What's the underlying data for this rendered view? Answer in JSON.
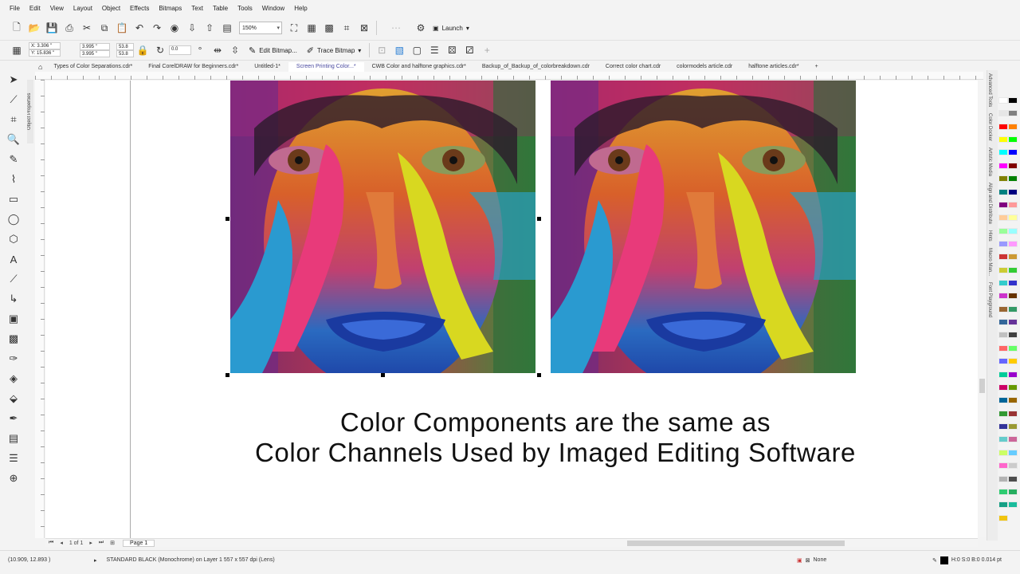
{
  "menu": [
    "File",
    "Edit",
    "View",
    "Layout",
    "Object",
    "Effects",
    "Bitmaps",
    "Text",
    "Table",
    "Tools",
    "Window",
    "Help"
  ],
  "toolbar": {
    "zoom": "150%",
    "launch_label": "Launch"
  },
  "propbar": {
    "x": "X: 3.306 \"",
    "y": "Y: 15.836 \"",
    "w": "3.995 \"",
    "h": "3.995 \"",
    "scale_w": "53.8",
    "scale_h": "53.8",
    "rotation": "0.0",
    "edit_bitmap": "Edit Bitmap...",
    "trace_bitmap": "Trace Bitmap"
  },
  "tabs": [
    {
      "label": "Types of Color Separations.cdr*",
      "active": false
    },
    {
      "label": "Final CorelDRAW for Beginners.cdr*",
      "active": false
    },
    {
      "label": "Untitled-1*",
      "active": false
    },
    {
      "label": "Screen Printing Color...*",
      "active": true
    },
    {
      "label": "CWB Color and halftone graphics.cdr*",
      "active": false
    },
    {
      "label": "Backup_of_Backup_of_colorbreakdown.cdr",
      "active": false
    },
    {
      "label": "Correct color chart.cdr",
      "active": false
    },
    {
      "label": "colormodels article.cdr",
      "active": false
    },
    {
      "label": "halftone articles.cdr*",
      "active": false
    }
  ],
  "side_docker_label": "Object Properties",
  "right_dockers": [
    "Advanced Tools",
    "Color Docker",
    "Artistic Media",
    "Align and Distribute",
    "Hints",
    "Macro Man...",
    "Font Playground"
  ],
  "canvas": {
    "caption_line1": "Color Components are the same as",
    "caption_line2": "Color Channels Used by Imaged Editing Software"
  },
  "pagenav": {
    "counter": "1 of 1",
    "page_label": "Page 1"
  },
  "status": {
    "cursor": "(10.909, 12.893 )",
    "description": "STANDARD BLACK (Monochrome) on Layer 1 557 x 557 dpi (Lens)",
    "fill": "None",
    "outline": "H:0 S:0 B:0  0.014 pt"
  },
  "palette_colors": [
    "#ffffff",
    "#000000",
    "#e6e6e6",
    "#808080",
    "#ff0000",
    "#ff8000",
    "#ffff00",
    "#00ff00",
    "#00ffff",
    "#0000ff",
    "#ff00ff",
    "#800000",
    "#808000",
    "#008000",
    "#008080",
    "#000080",
    "#800080",
    "#ff9999",
    "#ffcc99",
    "#ffff99",
    "#99ff99",
    "#99ffff",
    "#9999ff",
    "#ff99ff",
    "#cc3333",
    "#cc9933",
    "#cccc33",
    "#33cc33",
    "#33cccc",
    "#3333cc",
    "#cc33cc",
    "#663300",
    "#996633",
    "#339966",
    "#336699",
    "#663399",
    "#c0c0c0",
    "#404040",
    "#ff6666",
    "#66ff66",
    "#6666ff",
    "#ffcc00",
    "#00cc99",
    "#9900cc",
    "#cc0066",
    "#669900",
    "#006699",
    "#996600",
    "#339933",
    "#993333",
    "#333399",
    "#999933",
    "#66cccc",
    "#cc6699",
    "#ccff66",
    "#66ccff",
    "#ff66cc",
    "#cccccc",
    "#b3b3b3",
    "#4d4d4d",
    "#2ecc71",
    "#27ae60",
    "#16a085",
    "#1abc9c",
    "#f1c40f"
  ]
}
